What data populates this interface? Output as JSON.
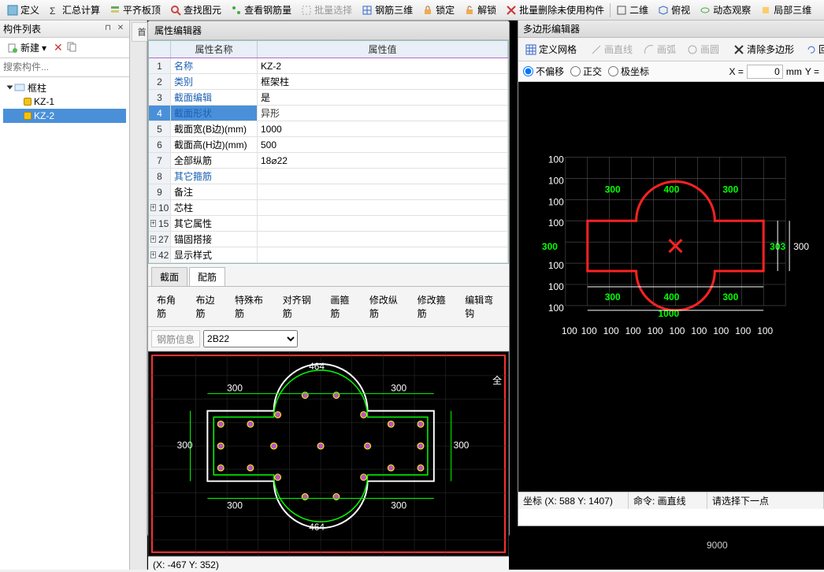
{
  "toolbar": {
    "define": "定义",
    "sum": "汇总计算",
    "align_top": "平齐板顶",
    "find": "查找图元",
    "check_rebar": "查看钢筋量",
    "batch_sel": "批量选择",
    "rebar_3d": "钢筋三维",
    "lock": "锁定",
    "unlock": "解锁",
    "batch_del": "批量删除未使用构件",
    "two_d": "二维",
    "persp": "俯视",
    "dyn_obs": "动态观察",
    "local_3d": "局部三维"
  },
  "left": {
    "title": "构件列表",
    "new_btn": "新建",
    "search_ph": "搜索构件...",
    "tree_root": "框柱",
    "kz1": "KZ-1",
    "kz2": "KZ-2"
  },
  "mid_tab": "首",
  "pe": {
    "title": "属性编辑器",
    "hdr_name": "属性名称",
    "hdr_val": "属性值",
    "rows": [
      {
        "n": "1",
        "k": "名称",
        "v": "KZ-2",
        "b": true
      },
      {
        "n": "2",
        "k": "类别",
        "v": "框架柱",
        "b": true
      },
      {
        "n": "3",
        "k": "截面编辑",
        "v": "是",
        "b": true
      },
      {
        "n": "4",
        "k": "截面形状",
        "v": "异形",
        "b": true,
        "sel": true
      },
      {
        "n": "5",
        "k": "截面宽(B边)(mm)",
        "v": "1000"
      },
      {
        "n": "6",
        "k": "截面高(H边)(mm)",
        "v": "500"
      },
      {
        "n": "7",
        "k": "全部纵筋",
        "v": "18⌀22"
      },
      {
        "n": "8",
        "k": "其它箍筋",
        "v": "",
        "b": true
      },
      {
        "n": "9",
        "k": "备注",
        "v": ""
      },
      {
        "n": "10",
        "k": "芯柱",
        "v": "",
        "exp": true
      },
      {
        "n": "15",
        "k": "其它属性",
        "v": "",
        "exp": true
      },
      {
        "n": "27",
        "k": "锚固搭接",
        "v": "",
        "exp": true
      },
      {
        "n": "42",
        "k": "显示样式",
        "v": "",
        "exp": true
      }
    ],
    "tab_section": "截面",
    "tab_rebar": "配筋",
    "cfg": [
      "布角筋",
      "布边筋",
      "特殊布筋",
      "对齐钢筋",
      "画箍筋",
      "修改纵筋",
      "修改箍筋",
      "编辑弯钩"
    ],
    "rebar_lbl": "钢筋信息",
    "rebar_val": "2B22",
    "labels": {
      "d464a": "464",
      "d464b": "464",
      "d300a": "300",
      "d300b": "300",
      "d300c": "300",
      "d300d": "300",
      "d300e": "300",
      "d300f": "300",
      "full": "全"
    },
    "status": "(X: -467 Y: 352)"
  },
  "rp": {
    "title": "多边形编辑器",
    "tools": {
      "grid": "定义网格",
      "line": "画直线",
      "arc": "画弧",
      "circle": "画圆",
      "clear": "清除多边形",
      "back": "回退"
    },
    "modes": {
      "none": "不偏移",
      "ortho": "正交",
      "polar": "极坐标"
    },
    "xlbl": "X =",
    "ylbl": "Y =",
    "xval": "0",
    "unit": "mm",
    "labels": {
      "v100": "100",
      "h100": "100",
      "g300": "300",
      "g400": "400",
      "g1000": "1000",
      "g303": "303",
      "g300r": "300"
    },
    "status_coord": "坐标 (X: 588 Y: 1407)",
    "status_cmd": "命令: 画直线",
    "status_hint": "请选择下一点"
  },
  "bg_num": "9000"
}
